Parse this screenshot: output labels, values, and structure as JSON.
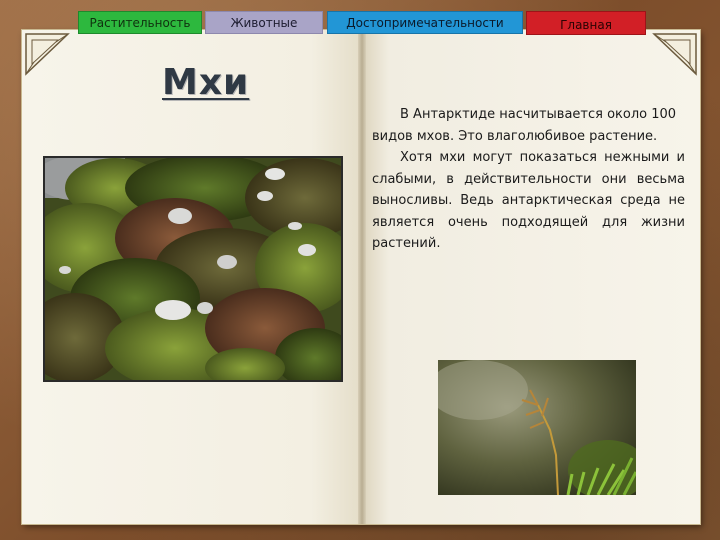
{
  "nav": {
    "tabs": [
      {
        "label": "Растительность",
        "color": "#2db83e"
      },
      {
        "label": "Животные",
        "color": "#a9a4c7"
      },
      {
        "label": "Достопримечательности",
        "color": "#2296d6"
      },
      {
        "label": "Главная",
        "color": "#d21f26"
      }
    ]
  },
  "page": {
    "title": "Мхи"
  },
  "content": {
    "paragraph1": "В Антарктиде насчитывается около 100 видов мхов. Это влаголюбивое растение.",
    "paragraph2": "Хотя мхи могут показаться нежными и слабыми, в действительности они весьма выносливы. Ведь антарктическая среда не является очень подходящей для жизни растений."
  },
  "images": {
    "main": "moss-on-rocks-photo",
    "small": "moss-sprout-closeup-photo"
  },
  "icons": {
    "corners": "page-corner-ornament-icon"
  }
}
